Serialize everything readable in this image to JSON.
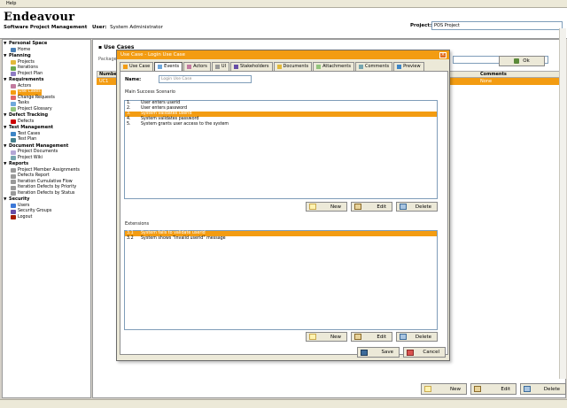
{
  "menu": {
    "help": "Help"
  },
  "header": {
    "app_title": "Endeavour",
    "subtitle": "Software Project Management",
    "user_label": "User:",
    "user_name": "System Administrator",
    "project_label": "Project:",
    "project_value": "POS Project"
  },
  "tree": {
    "groups": [
      {
        "label": "Personal Space",
        "items": [
          {
            "label": "Home",
            "icon": "home-icon"
          }
        ]
      },
      {
        "label": "Planning",
        "items": [
          {
            "label": "Projects",
            "icon": "folder-icon"
          },
          {
            "label": "Iterations",
            "icon": "iteration-icon"
          },
          {
            "label": "Project Plan",
            "icon": "plan-icon"
          }
        ]
      },
      {
        "label": "Requirements",
        "items": [
          {
            "label": "Actors",
            "icon": "actor-icon"
          },
          {
            "label": "Use Cases",
            "icon": "use-case-icon",
            "active": true
          },
          {
            "label": "Change Requests",
            "icon": "change-request-icon"
          },
          {
            "label": "Tasks",
            "icon": "task-icon"
          },
          {
            "label": "Project Glossary",
            "icon": "glossary-icon"
          }
        ]
      },
      {
        "label": "Defect Tracking",
        "items": [
          {
            "label": "Defects",
            "icon": "defect-icon"
          }
        ]
      },
      {
        "label": "Test Management",
        "items": [
          {
            "label": "Test Cases",
            "icon": "test-case-icon"
          },
          {
            "label": "Test Plan",
            "icon": "test-plan-icon"
          }
        ]
      },
      {
        "label": "Document Management",
        "items": [
          {
            "label": "Project Documents",
            "icon": "document-icon"
          },
          {
            "label": "Project Wiki",
            "icon": "wiki-icon"
          }
        ]
      },
      {
        "label": "Reports",
        "items": [
          {
            "label": "Project Member Assignments",
            "icon": "report-icon"
          },
          {
            "label": "Defects Report",
            "icon": "report-icon"
          },
          {
            "label": "Iteration Cumulative Flow",
            "icon": "report-icon"
          },
          {
            "label": "Iteration Defects by Priority",
            "icon": "report-icon"
          },
          {
            "label": "Iteration Defects by Status",
            "icon": "report-icon"
          }
        ]
      },
      {
        "label": "Security",
        "items": [
          {
            "label": "Users",
            "icon": "user-icon"
          },
          {
            "label": "Security Groups",
            "icon": "group-icon"
          },
          {
            "label": "Logout",
            "icon": "logout-icon"
          }
        ]
      }
    ]
  },
  "main": {
    "title": "Use Cases",
    "filter_label": "Package",
    "ok_label": "Ok",
    "grid": {
      "col_number": "Number",
      "col_comments": "Comments",
      "row_number": "UC1",
      "row_comments": "None"
    },
    "buttons": {
      "new": "New",
      "edit": "Edit",
      "delete": "Delete"
    }
  },
  "dialog": {
    "title": "Use Case - Login Use Case",
    "tabs": [
      "Use Case",
      "Events",
      "Actors",
      "UI",
      "Stakeholders",
      "Documents",
      "Attachments",
      "Comments",
      "Preview"
    ],
    "active_tab": 1,
    "name_label": "Name:",
    "name_value": "Login Use Case",
    "main_flow_label": "Main Success Scenario",
    "main_flow": [
      {
        "num": "1.",
        "text": "User enters userid"
      },
      {
        "num": "2.",
        "text": "User enters password"
      },
      {
        "num": "3.",
        "text": "System validates userid",
        "selected": true
      },
      {
        "num": "4.",
        "text": "System validates password"
      },
      {
        "num": "5.",
        "text": "System grants user access to the system"
      }
    ],
    "extensions_label": "Extensions",
    "extensions": [
      {
        "num": "3.1",
        "text": "System fails to validate userid",
        "selected": true
      },
      {
        "num": "3.2",
        "text": "System shows \"Invalid userid\" message"
      }
    ],
    "buttons": {
      "new": "New",
      "edit": "Edit",
      "delete": "Delete",
      "save": "Save",
      "cancel": "Cancel"
    }
  },
  "colors": {
    "accent": "#f39c12"
  }
}
